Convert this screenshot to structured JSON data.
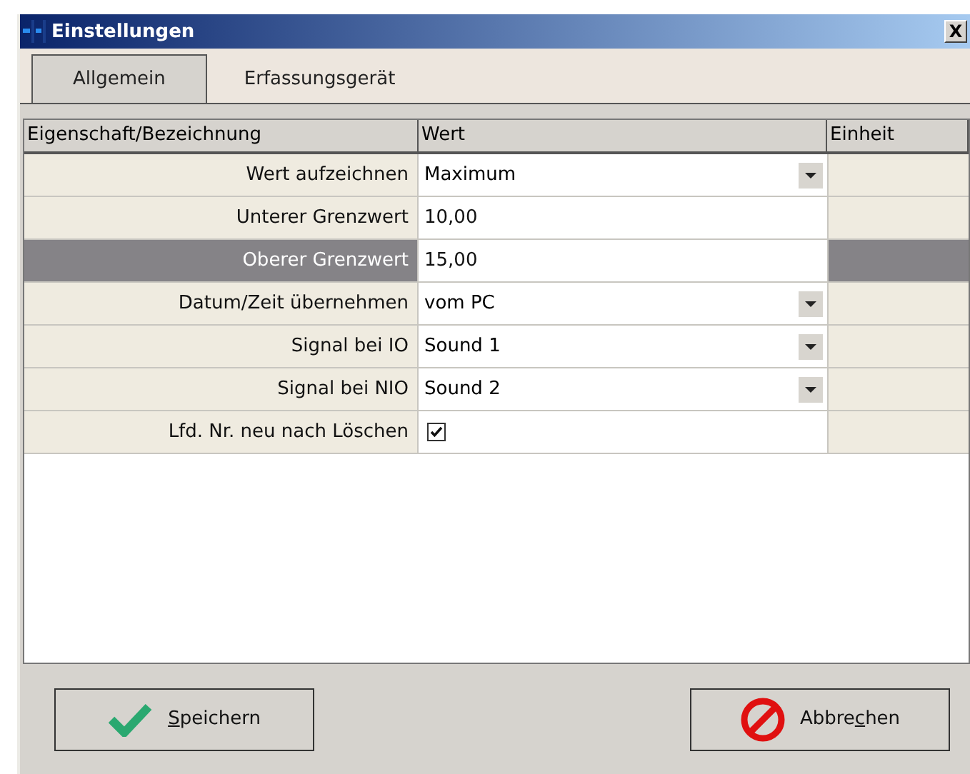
{
  "window": {
    "title": "Einstellungen",
    "close": "X"
  },
  "tabs": [
    {
      "label": "Allgemein",
      "selected": true
    },
    {
      "label": "Erfassungsgerät",
      "selected": false
    }
  ],
  "table": {
    "columns": [
      "Eigenschaft/Bezeichnung",
      "Wert",
      "Einheit"
    ],
    "rows": [
      {
        "name": "Wert aufzeichnen",
        "kind": "select",
        "value": "Maximum",
        "selected": false
      },
      {
        "name": "Unterer Grenzwert",
        "kind": "text",
        "value": "10,00",
        "selected": false
      },
      {
        "name": "Oberer Grenzwert",
        "kind": "text",
        "value": "15,00",
        "selected": true
      },
      {
        "name": "Datum/Zeit übernehmen",
        "kind": "select",
        "value": "vom PC",
        "selected": false
      },
      {
        "name": "Signal bei IO",
        "kind": "select",
        "value": "Sound 1",
        "selected": false
      },
      {
        "name": "Signal bei NIO",
        "kind": "select",
        "value": "Sound 2",
        "selected": false
      },
      {
        "name": "Lfd. Nr. neu nach Löschen",
        "kind": "checkbox",
        "checked": true,
        "selected": false
      }
    ]
  },
  "buttons": [
    {
      "kind": "save",
      "access_key": "S",
      "after": "peichern"
    },
    {
      "kind": "cancel",
      "before": "Abbre",
      "access_key": "c",
      "after": "hen"
    }
  ]
}
